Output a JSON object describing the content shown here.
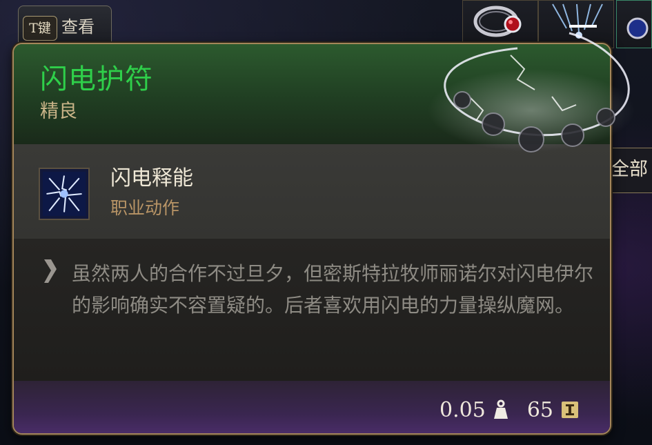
{
  "keyhint": {
    "key": "T键",
    "label": "查看"
  },
  "side_panel": {
    "label": "全部"
  },
  "item": {
    "name": "闪电护符",
    "rarity": "精良",
    "action": {
      "name": "闪电释能",
      "type": "职业动作"
    },
    "description": "虽然两人的合作不过旦夕，但密斯特拉牧师丽诺尔对闪电伊尔的影响确实不容置疑的。后者喜欢用闪电的力量操纵魔网。",
    "weight": "0.05",
    "value": "65"
  },
  "colors": {
    "title": "#2fcf4a",
    "rarity": "#c9b488",
    "action_type": "#b99566",
    "border": "#a4865a"
  },
  "icons": [
    "weight-icon",
    "gold-coin-icon",
    "lightning-action-icon",
    "quote-icon",
    "ring-icon",
    "amulet-icon"
  ]
}
